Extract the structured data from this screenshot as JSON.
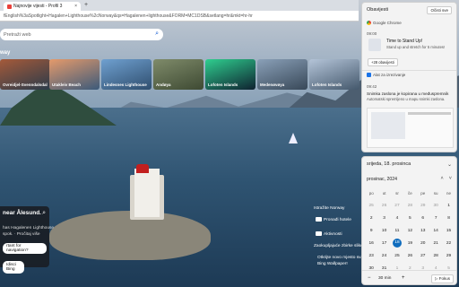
{
  "browser": {
    "tab_title": "Najnovije vijesti - Profil 3",
    "new_tab": "+",
    "tab_close": "×",
    "address": "fEnglish%3aSpotlight+Hagalen+Lighthouse%2cNorway&qs=Hagalenen+lighthouse&FORM=MC1DSB&setlang=hr&mkt=hr-hr"
  },
  "bing": {
    "search_placeholder": "Pretraži web",
    "section_label": "way",
    "thumbnails": [
      {
        "label": "Ovreidjel-Svenndalsdal"
      },
      {
        "label": "Utakleiv Beach"
      },
      {
        "label": "Lindesnes Lighthouse"
      },
      {
        "label": "Andøya"
      },
      {
        "label": "Lofoten Islands"
      },
      {
        "label": "Medenøvøya"
      },
      {
        "label": "Lofoten Islands"
      }
    ],
    "infocard": {
      "title": "near Ålesund.",
      "line1": "has Hagalenen Lighthouse",
      "line2": "spok. · Pročitaj više",
      "nav_btn": "rtant for navigation?",
      "quiz_btn": "Idisci Bing"
    },
    "side_links": [
      "Istražite Norway",
      "Pronađi hotele",
      "Aktivnosti",
      "Zaokupljajuće zbirke slike",
      "Otkrijte novo mjesto svake",
      "Bing Wallpaper!"
    ]
  },
  "notifications": {
    "header": "Obavijesti",
    "clear_all": "Očisti sve",
    "app1": "Google Chrome",
    "time1": "09:00",
    "card_title": "Time to Stand Up!",
    "card_text": "Stand up and stretch for 5 minutes!",
    "more_label": "+28 obavijesti",
    "app2": "Alat za izrezivanje",
    "time2": "09:42",
    "snip_title": "Snimka zaslona je kopirana u međuspremnik",
    "snip_text": "Automatski spremljeno u mapu snimki zaslona."
  },
  "calendar": {
    "date_label": "srijeda, 18. prosinca",
    "collapse": "⌄",
    "month": "prosinac, 2024",
    "nav_up": "˄",
    "nav_down": "˅",
    "weekdays": [
      "po",
      "ut",
      "sr",
      "če",
      "pe",
      "su",
      "ne"
    ],
    "weeks": [
      [
        "25",
        "26",
        "27",
        "28",
        "29",
        "30",
        "1"
      ],
      [
        "2",
        "3",
        "4",
        "5",
        "6",
        "7",
        "8"
      ],
      [
        "9",
        "10",
        "11",
        "12",
        "13",
        "14",
        "15"
      ],
      [
        "16",
        "17",
        "18",
        "19",
        "20",
        "21",
        "22"
      ],
      [
        "23",
        "24",
        "25",
        "26",
        "27",
        "28",
        "29"
      ],
      [
        "30",
        "31",
        "1",
        "2",
        "3",
        "4",
        "5"
      ]
    ],
    "today": "18",
    "focus_minutes": "30 min",
    "minus": "−",
    "plus": "+",
    "focus_btn": "▷ Fokus"
  }
}
